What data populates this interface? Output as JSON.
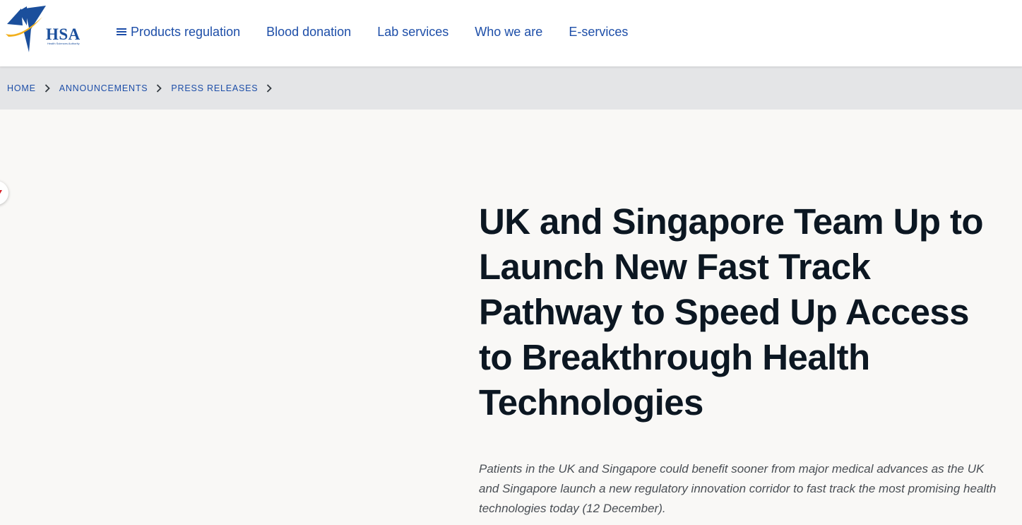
{
  "header": {
    "logo": {
      "text": "HSA",
      "subtitle": "Health Sciences Authority"
    },
    "nav": [
      {
        "label": "Products regulation",
        "icon": "menu-icon"
      },
      {
        "label": "Blood donation"
      },
      {
        "label": "Lab services"
      },
      {
        "label": "Who we are"
      },
      {
        "label": "E-services"
      }
    ]
  },
  "breadcrumb": [
    {
      "label": "HOME"
    },
    {
      "label": "ANNOUNCEMENTS"
    },
    {
      "label": "PRESS RELEASES"
    }
  ],
  "article": {
    "title": "UK and Singapore Team Up to Launch New Fast Track Pathway to Speed Up Access to Breakthrough Health Technologies",
    "lead": "Patients in the UK and Singapore could benefit sooner from major medical advances as the UK and Singapore launch a new regulatory innovation corridor to fast track the most promising health technologies today (12 December)."
  },
  "colors": {
    "brand_blue": "#1d4ea8",
    "title_text": "#0c1722",
    "page_bg": "#f9f8f6",
    "breadcrumb_bg": "#e4e5e7",
    "logo_yellow": "#f2b01e"
  }
}
